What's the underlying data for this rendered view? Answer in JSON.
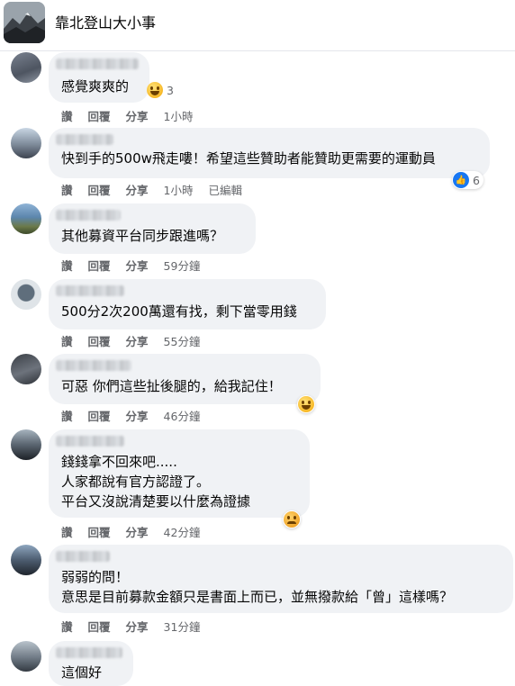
{
  "group": {
    "title": "靠北登山大小事"
  },
  "actions_labels": {
    "like": "讚",
    "reply": "回覆",
    "share": "分享"
  },
  "comments": [
    {
      "lines": [
        "感覺爽爽的"
      ],
      "time": "1小時",
      "edited": "",
      "reaction": {
        "icon": "laughing-emoji",
        "count": "3"
      }
    },
    {
      "lines": [
        "快到手的500w飛走嘍！希望這些贊助者能贊助更需要的運動員"
      ],
      "time": "1小時",
      "edited": "已編輯",
      "reaction": {
        "icon": "like-icon",
        "count": "6"
      }
    },
    {
      "lines": [
        "其他募資平台同步跟進嗎？"
      ],
      "time": "59分鐘",
      "edited": "",
      "reaction": null
    },
    {
      "lines": [
        "500分2次200萬還有找，剩下當零用錢"
      ],
      "time": "55分鐘",
      "edited": "",
      "reaction": null
    },
    {
      "lines": [
        "可惡 你們這些扯後腿的，給我記住！"
      ],
      "time": "46分鐘",
      "edited": "",
      "reaction": {
        "icon": "laughing-emoji",
        "count": ""
      }
    },
    {
      "lines": [
        "錢錢拿不回來吧.....",
        "人家都說有官方認證了。",
        "平台又沒說清楚要以什麼為證據"
      ],
      "time": "42分鐘",
      "edited": "",
      "reaction": {
        "icon": "sad-emoji",
        "count": ""
      }
    },
    {
      "lines": [
        "弱弱的問！",
        "意思是目前募款金額只是書面上而已，並無撥款給「曾」這樣嗎？"
      ],
      "time": "31分鐘",
      "edited": "",
      "reaction": null
    },
    {
      "lines": [
        "這個好"
      ],
      "time": "",
      "edited": "",
      "reaction": null
    }
  ],
  "colors": {
    "bubble": "#f0f2f5",
    "meta": "#65676b",
    "like": "#1877f2",
    "emoji": "#f7b928"
  }
}
